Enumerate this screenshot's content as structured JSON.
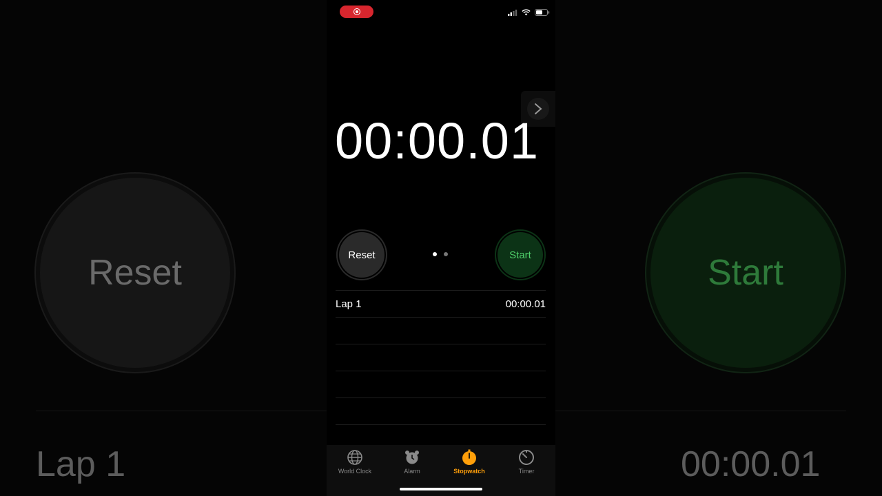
{
  "background": {
    "reset_label": "Reset",
    "start_label": "Start",
    "lap_label": "Lap 1",
    "lap_time": "00:00.01"
  },
  "status_bar": {
    "record_indicator": "screen-recording-icon",
    "icons": [
      "cellular-signal-icon",
      "wifi-icon",
      "battery-icon"
    ]
  },
  "stopwatch": {
    "display": "00:00.01",
    "reset_label": "Reset",
    "start_label": "Start",
    "page_count": 2,
    "active_page": 0
  },
  "laps": [
    {
      "label": "Lap 1",
      "time": "00:00.01"
    }
  ],
  "tabs": [
    {
      "label": "World Clock",
      "icon": "globe-icon",
      "active": false
    },
    {
      "label": "Alarm",
      "icon": "alarm-clock-icon",
      "active": false
    },
    {
      "label": "Stopwatch",
      "icon": "stopwatch-icon",
      "active": true
    },
    {
      "label": "Timer",
      "icon": "timer-icon",
      "active": false
    }
  ],
  "colors": {
    "accent": "#ff9f0a",
    "start_green": "#4fd06a",
    "record_red": "#d7262e"
  }
}
